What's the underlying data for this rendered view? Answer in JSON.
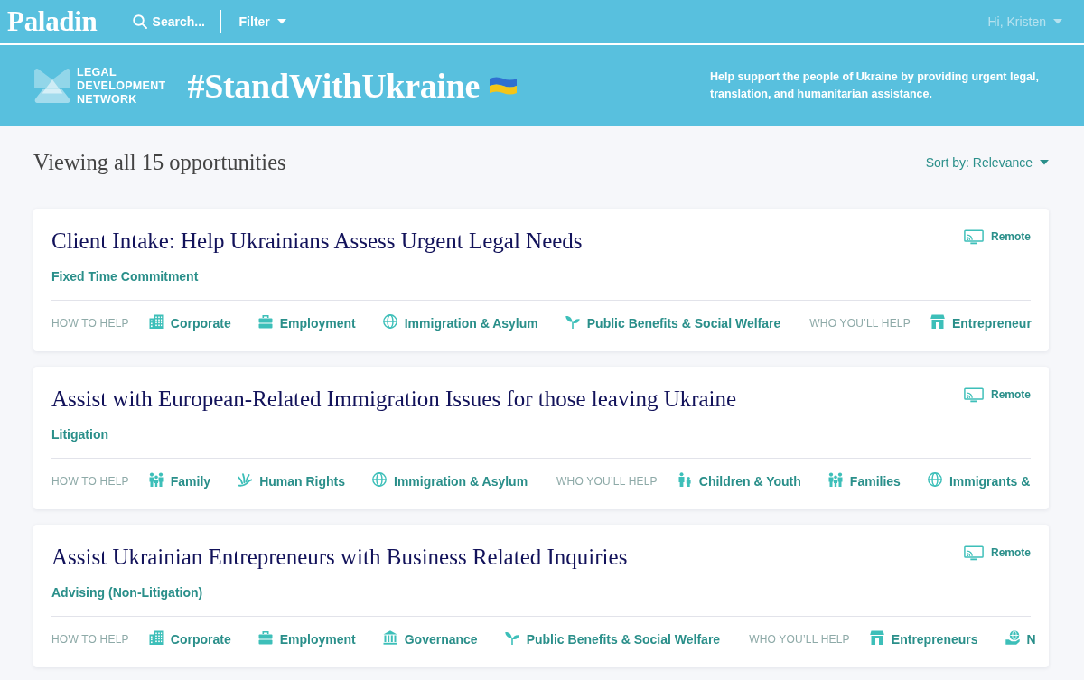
{
  "navbar": {
    "logo": "Paladin",
    "search": {
      "placeholder": "Search..."
    },
    "filter": "Filter",
    "user_menu": "Hi, Kristen"
  },
  "banner": {
    "org_name": "LEGAL DEVELOPMENT NETWORK",
    "hashtag": "#StandWithUkraine",
    "message": "Help support the people of Ukraine by providing urgent legal, translation, and humanitarian assistance."
  },
  "results": {
    "heading": "Viewing all 15 opportunities",
    "sort": "Sort by: Relevance"
  },
  "opportunities": [
    {
      "title": "Client Intake: Help Ukrainians Assess Urgent Legal Needs",
      "commitment": "Fixed Time Commitment",
      "location": "Remote",
      "groups": [
        {
          "label": "HOW TO HELP",
          "tags": [
            {
              "kind": "building",
              "label": "Corporate"
            },
            {
              "kind": "briefcase",
              "label": "Employment"
            },
            {
              "kind": "globe",
              "label": "Immigration & Asylum"
            },
            {
              "kind": "sprout",
              "label": "Public Benefits & Social Welfare"
            }
          ]
        },
        {
          "label": "WHO YOU’LL HELP",
          "tags": [
            {
              "kind": "store",
              "label": "Entrepreneur"
            }
          ]
        }
      ]
    },
    {
      "title": "Assist with European-Related Immigration Issues for those leaving Ukraine",
      "commitment": "Litigation",
      "location": "Remote",
      "groups": [
        {
          "label": "HOW TO HELP",
          "tags": [
            {
              "kind": "family",
              "label": "Family"
            },
            {
              "kind": "hand",
              "label": "Human Rights"
            },
            {
              "kind": "globe",
              "label": "Immigration & Asylum"
            }
          ]
        },
        {
          "label": "WHO YOU’LL HELP",
          "tags": [
            {
              "kind": "parent-child",
              "label": "Children & Youth"
            },
            {
              "kind": "family",
              "label": "Families"
            },
            {
              "kind": "globe",
              "label": "Immigrants &"
            }
          ]
        }
      ]
    },
    {
      "title": "Assist Ukrainian Entrepreneurs with Business Related Inquiries",
      "commitment": "Advising (Non-Litigation)",
      "location": "Remote",
      "groups": [
        {
          "label": "HOW TO HELP",
          "tags": [
            {
              "kind": "building",
              "label": "Corporate"
            },
            {
              "kind": "briefcase",
              "label": "Employment"
            },
            {
              "kind": "columns",
              "label": "Governance"
            },
            {
              "kind": "sprout",
              "label": "Public Benefits & Social Welfare"
            }
          ]
        },
        {
          "label": "WHO YOU’LL HELP",
          "tags": [
            {
              "kind": "store",
              "label": "Entrepreneurs"
            },
            {
              "kind": "globe-hand",
              "label": "N"
            }
          ]
        }
      ]
    }
  ]
}
